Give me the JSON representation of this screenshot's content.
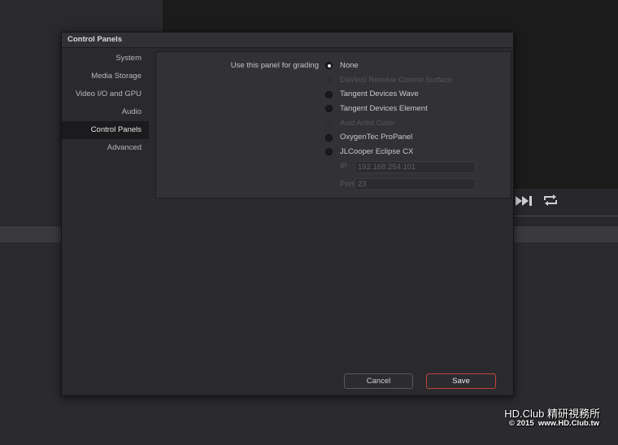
{
  "background": {
    "transport_icons": [
      "skip-to-end-icon",
      "loop-icon"
    ]
  },
  "dialog": {
    "title": "Control Panels",
    "sidebar": {
      "items": [
        {
          "label": "System",
          "selected": false
        },
        {
          "label": "Media Storage",
          "selected": false
        },
        {
          "label": "Video I/O and GPU",
          "selected": false
        },
        {
          "label": "Audio",
          "selected": false
        },
        {
          "label": "Control Panels",
          "selected": true
        },
        {
          "label": "Advanced",
          "selected": false
        }
      ]
    },
    "content": {
      "grading_label": "Use this panel for grading",
      "options": [
        {
          "label": "None",
          "selected": true,
          "enabled": true
        },
        {
          "label": "DaVinci Resolve Control Surface",
          "selected": false,
          "enabled": false
        },
        {
          "label": "Tangent Devices Wave",
          "selected": false,
          "enabled": true
        },
        {
          "label": "Tangent Devices Element",
          "selected": false,
          "enabled": true
        },
        {
          "label": "Avid Artist Color",
          "selected": false,
          "enabled": false
        },
        {
          "label": "OxygenTec ProPanel",
          "selected": false,
          "enabled": true
        },
        {
          "label": "JLCooper Eclipse CX",
          "selected": false,
          "enabled": true
        }
      ],
      "ip": {
        "label": "IP",
        "value": "192.168.254.101"
      },
      "port": {
        "label": "Port",
        "value": "23"
      }
    },
    "buttons": {
      "cancel": "Cancel",
      "save": "Save"
    }
  },
  "watermark": {
    "line1": "HD.Club 精研視務所",
    "line2": "© 2015  www.HD.Club.tw"
  },
  "colors": {
    "save_button_border": "#c0433a",
    "selected_sidebar_bg": "#1b1b1d"
  }
}
